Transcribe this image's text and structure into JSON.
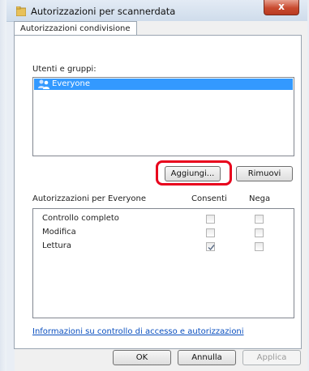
{
  "window": {
    "title": "Autorizzazioni per scannerdata",
    "close_label": "x"
  },
  "tab": {
    "label": "Autorizzazioni condivisione"
  },
  "users": {
    "label": "Utenti e gruppi:",
    "items": [
      {
        "name": "Everyone",
        "icon": "users-group-icon",
        "selected": true
      }
    ]
  },
  "buttons": {
    "add_label": "Aggiungi...",
    "remove_label": "Rimuovi",
    "ok_label": "OK",
    "cancel_label": "Annulla",
    "apply_label": "Applica"
  },
  "permissions": {
    "header": "Autorizzazioni per Everyone",
    "allow_header": "Consenti",
    "deny_header": "Nega",
    "rows": [
      {
        "name": "Controllo completo",
        "allow": false,
        "deny": false
      },
      {
        "name": "Modifica",
        "allow": false,
        "deny": false
      },
      {
        "name": "Lettura",
        "allow": true,
        "deny": false
      }
    ]
  },
  "info_link": "Informazioni su controllo di accesso e autorizzazioni",
  "colors": {
    "highlight": "#e8001c",
    "selection": "#3399ff",
    "link": "#0a4fbf"
  }
}
